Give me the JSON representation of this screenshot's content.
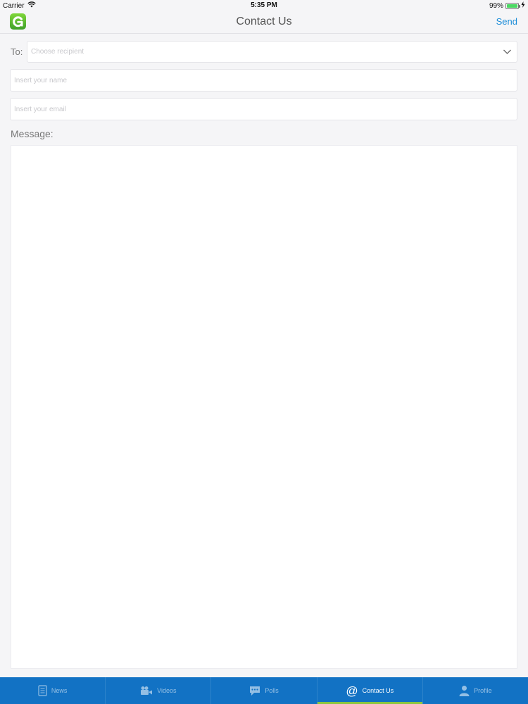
{
  "status_bar": {
    "carrier": "Carrier",
    "time": "5:35 PM",
    "battery": "99%",
    "battery_level": 0.99
  },
  "nav": {
    "title": "Contact Us",
    "send_label": "Send",
    "logo_icon": "app-logo-icon"
  },
  "form": {
    "to_label": "To:",
    "recipient_placeholder": "Choose recipient",
    "name_placeholder": "Insert your name",
    "email_placeholder": "Insert your email",
    "message_label": "Message:",
    "message_value": ""
  },
  "tabs": [
    {
      "label": "News",
      "icon": "news-icon",
      "active": false
    },
    {
      "label": "Videos",
      "icon": "videos-icon",
      "active": false
    },
    {
      "label": "Polls",
      "icon": "polls-icon",
      "active": false
    },
    {
      "label": "Contact Us",
      "icon": "at-icon",
      "active": true
    },
    {
      "label": "Profile",
      "icon": "profile-icon",
      "active": false
    }
  ],
  "colors": {
    "accent": "#1a8cd8",
    "tab_bar": "#1272c4",
    "active_indicator": "#8cc63f"
  }
}
